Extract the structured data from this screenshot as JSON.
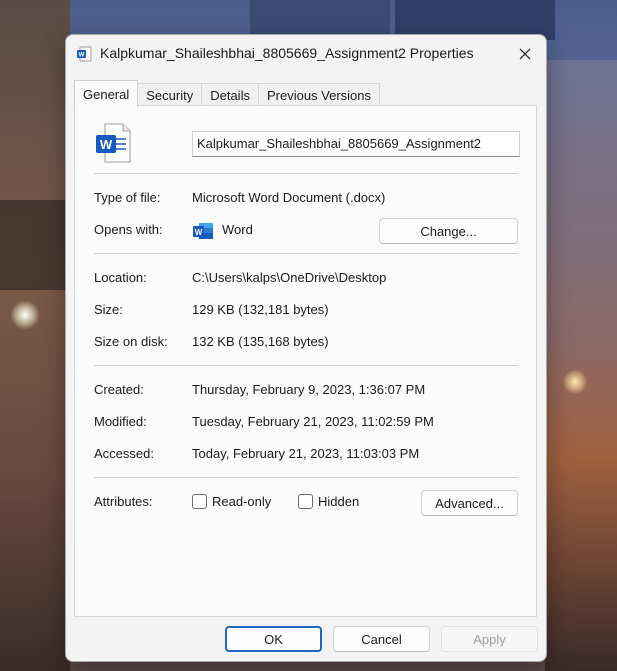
{
  "window": {
    "title": "Kalpkumar_Shaileshbhai_8805669_Assignment2 Properties",
    "icon": "word-document-icon"
  },
  "tabs": [
    "General",
    "Security",
    "Details",
    "Previous Versions"
  ],
  "general": {
    "file_name": "Kalpkumar_Shaileshbhai_8805669_Assignment2",
    "type_label": "Type of file:",
    "type_value": "Microsoft Word Document (.docx)",
    "opens_label": "Opens with:",
    "opens_value": "Word",
    "change_label": "Change...",
    "location_label": "Location:",
    "location_value": "C:\\Users\\kalps\\OneDrive\\Desktop",
    "size_label": "Size:",
    "size_value": "129 KB (132,181 bytes)",
    "size_disk_label": "Size on disk:",
    "size_disk_value": "132 KB (135,168 bytes)",
    "created_label": "Created:",
    "created_value": "Thursday, February 9, 2023, 1:36:07 PM",
    "modified_label": "Modified:",
    "modified_value": "Tuesday, February 21, 2023, 11:02:59 PM",
    "accessed_label": "Accessed:",
    "accessed_value": "Today, February 21, 2023, 11:03:03 PM",
    "attributes_label": "Attributes:",
    "readonly_label": "Read-only",
    "hidden_label": "Hidden",
    "advanced_label": "Advanced..."
  },
  "footer": {
    "ok": "OK",
    "cancel": "Cancel",
    "apply": "Apply"
  },
  "colors": {
    "accent": "#1f67c2",
    "word_blue": "#185abd"
  }
}
